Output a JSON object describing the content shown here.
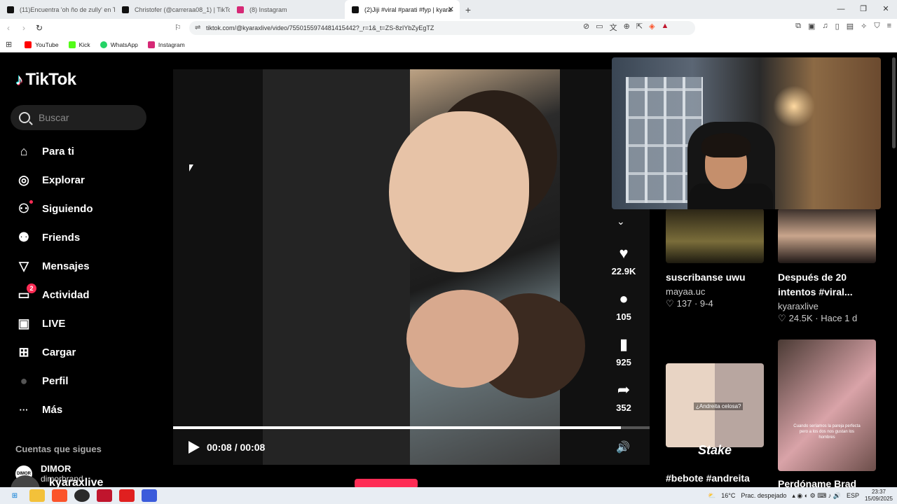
{
  "browser": {
    "tabs": [
      {
        "title": "(11)Encuentra 'oh ño de zully' en TikT",
        "color": "#111111",
        "active": false
      },
      {
        "title": "Christofer (@carreraa08_1) | TikTok",
        "color": "#111111",
        "active": false
      },
      {
        "title": "(8) Instagram",
        "color": "#d62976",
        "active": false
      },
      {
        "title": "(2)Jiji #viral #parati #fyp | kyara",
        "color": "#111111",
        "active": true
      }
    ],
    "url": "tiktok.com/@kyaraxlive/video/7550155974481415442?_r=1&_t=ZS-8zIYbZyEgTZ",
    "bookmarks": [
      {
        "label": "YouTube",
        "color": "#ff0000"
      },
      {
        "label": "Kick",
        "color": "#53fc18"
      },
      {
        "label": "WhatsApp",
        "color": "#25d366"
      },
      {
        "label": "Instagram",
        "color": "#d62976"
      }
    ]
  },
  "sidebar": {
    "logo": "TikTok",
    "search_placeholder": "Buscar",
    "items": [
      {
        "label": "Para ti",
        "icon": "home-icon",
        "glyph": "⌂"
      },
      {
        "label": "Explorar",
        "icon": "compass-icon",
        "glyph": "◎"
      },
      {
        "label": "Siguiendo",
        "icon": "following-icon",
        "glyph": "⚇"
      },
      {
        "label": "Friends",
        "icon": "friends-icon",
        "glyph": "⚉"
      },
      {
        "label": "Mensajes",
        "icon": "messages-icon",
        "glyph": "▽"
      },
      {
        "label": "Actividad",
        "icon": "activity-icon",
        "glyph": "▭",
        "badge": "2"
      },
      {
        "label": "LIVE",
        "icon": "live-icon",
        "glyph": "▣"
      },
      {
        "label": "Cargar",
        "icon": "upload-icon",
        "glyph": "⊞"
      },
      {
        "label": "Perfil",
        "icon": "profile-avatar",
        "glyph": "●"
      },
      {
        "label": "Más",
        "icon": "more-icon",
        "glyph": "···"
      }
    ],
    "following_header": "Cuentas que sigues",
    "following": [
      {
        "name": "DIMOR",
        "handle": "dimorbrand",
        "avatar_text": "DIMOR"
      }
    ]
  },
  "video": {
    "progress": 0.94,
    "time": "00:08 / 00:08",
    "author": "kyaraxlive",
    "actions": [
      {
        "icon": "heart-icon",
        "glyph": "♥",
        "count": "22.9K"
      },
      {
        "icon": "comment-icon",
        "glyph": "💬",
        "count": "105"
      },
      {
        "icon": "bookmark-icon",
        "glyph": "🔖",
        "count": "925"
      },
      {
        "icon": "share-icon",
        "glyph": "➦",
        "count": "352"
      }
    ]
  },
  "related": [
    {
      "title": "suscribanse uwu",
      "author": "mayaa.uc",
      "likes": "137",
      "date": "9-4"
    },
    {
      "title": "Después de 20 intentos #viral...",
      "author": "kyaraxlive",
      "likes": "24.5K",
      "date": "Hace 1 d"
    },
    {
      "title": "#bebote #andreita",
      "overlay": "Stake",
      "caption": "¿Andreita celosa?"
    },
    {
      "title": "Perdóname Brad",
      "caption": "Cuando seríamos la pareja perfecta pero a los dos nos gustan los hombres"
    }
  ],
  "taskbar": {
    "weather": "16°C",
    "weather_desc": "Prac. despejado",
    "lang": "ESP",
    "time": "23:37",
    "date": "15/09/2025"
  }
}
